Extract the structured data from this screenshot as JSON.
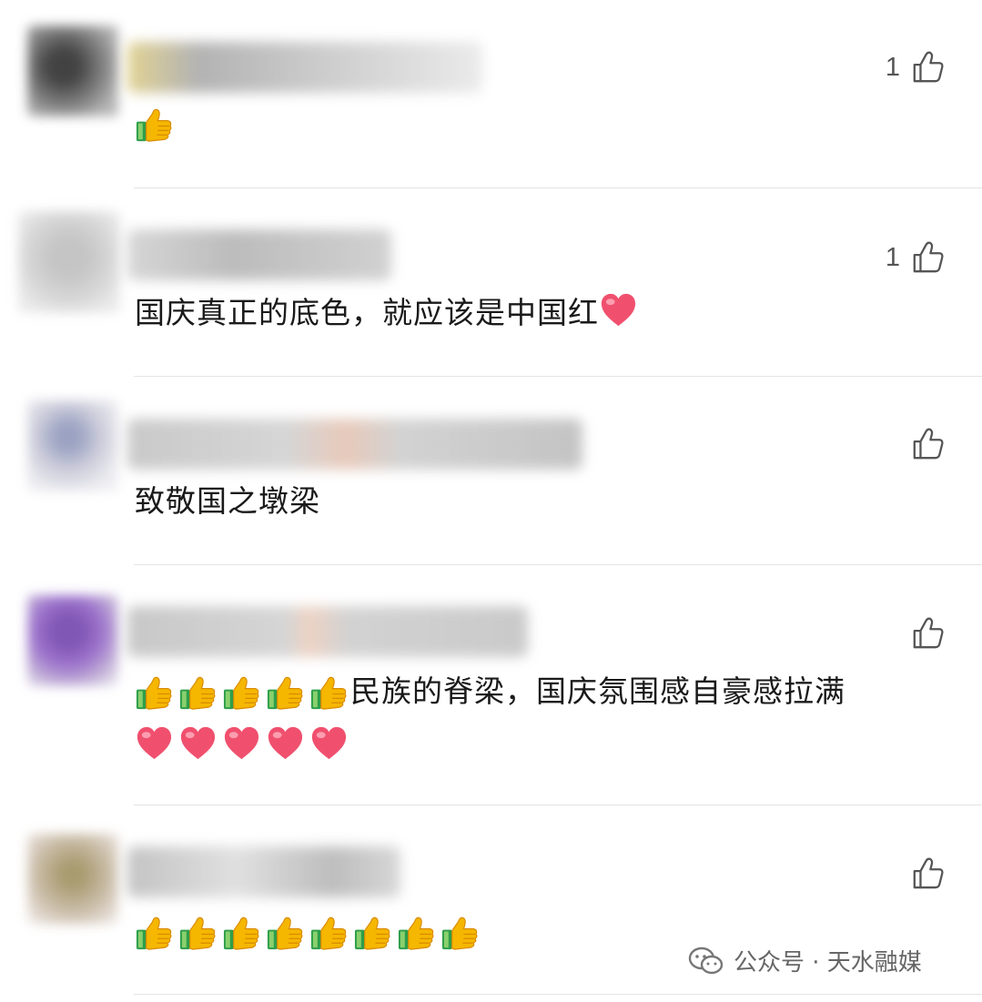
{
  "comments": [
    {
      "likes": "1",
      "text": ""
    },
    {
      "likes": "1",
      "text": "国庆真正的底色，就应该是中国红"
    },
    {
      "likes": "",
      "text": "致敬国之墩梁"
    },
    {
      "likes": "",
      "text": "民族的脊梁，国庆氛围感自豪感拉满"
    },
    {
      "likes": "",
      "text": ""
    }
  ],
  "icons": {
    "like": "thumbs-up-outline-icon",
    "thumb_emoji": "thumbs-up-emoji",
    "heart_emoji": "red-heart-emoji",
    "wechat": "wechat-logo-icon"
  },
  "colors": {
    "divider": "#e4e4e4",
    "icon": "#555555",
    "heart": "#f0506e",
    "thumb": "#f5b700",
    "sleeve": "#2e9e4a"
  },
  "watermark": {
    "text": "公众号 · 天水融媒"
  }
}
